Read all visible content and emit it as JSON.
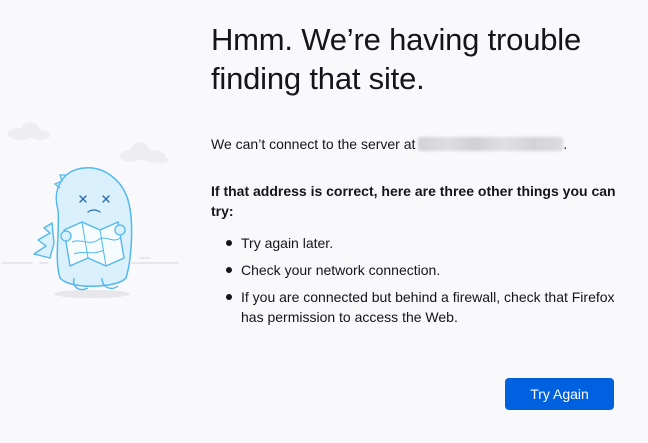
{
  "error": {
    "title": "Hmm. We’re having trouble finding that site.",
    "description_prefix": "We can’t connect to the server at",
    "description_suffix": ".",
    "suggestions_title": "If that address is correct, here are three other things you can try:",
    "suggestions": [
      "Try again later.",
      "Check your network connection.",
      "If you are connected but behind a firewall, check that Firefox has permission to access the Web."
    ],
    "try_again_label": "Try Again"
  },
  "illustration": {
    "icon": "lost-dino-with-map-icon"
  },
  "colors": {
    "background": "#f9f9fb",
    "text": "#15141a",
    "primary_button": "#0061e0",
    "illustration_outline": "#53b8ee",
    "illustration_fill": "#daf0fc"
  }
}
